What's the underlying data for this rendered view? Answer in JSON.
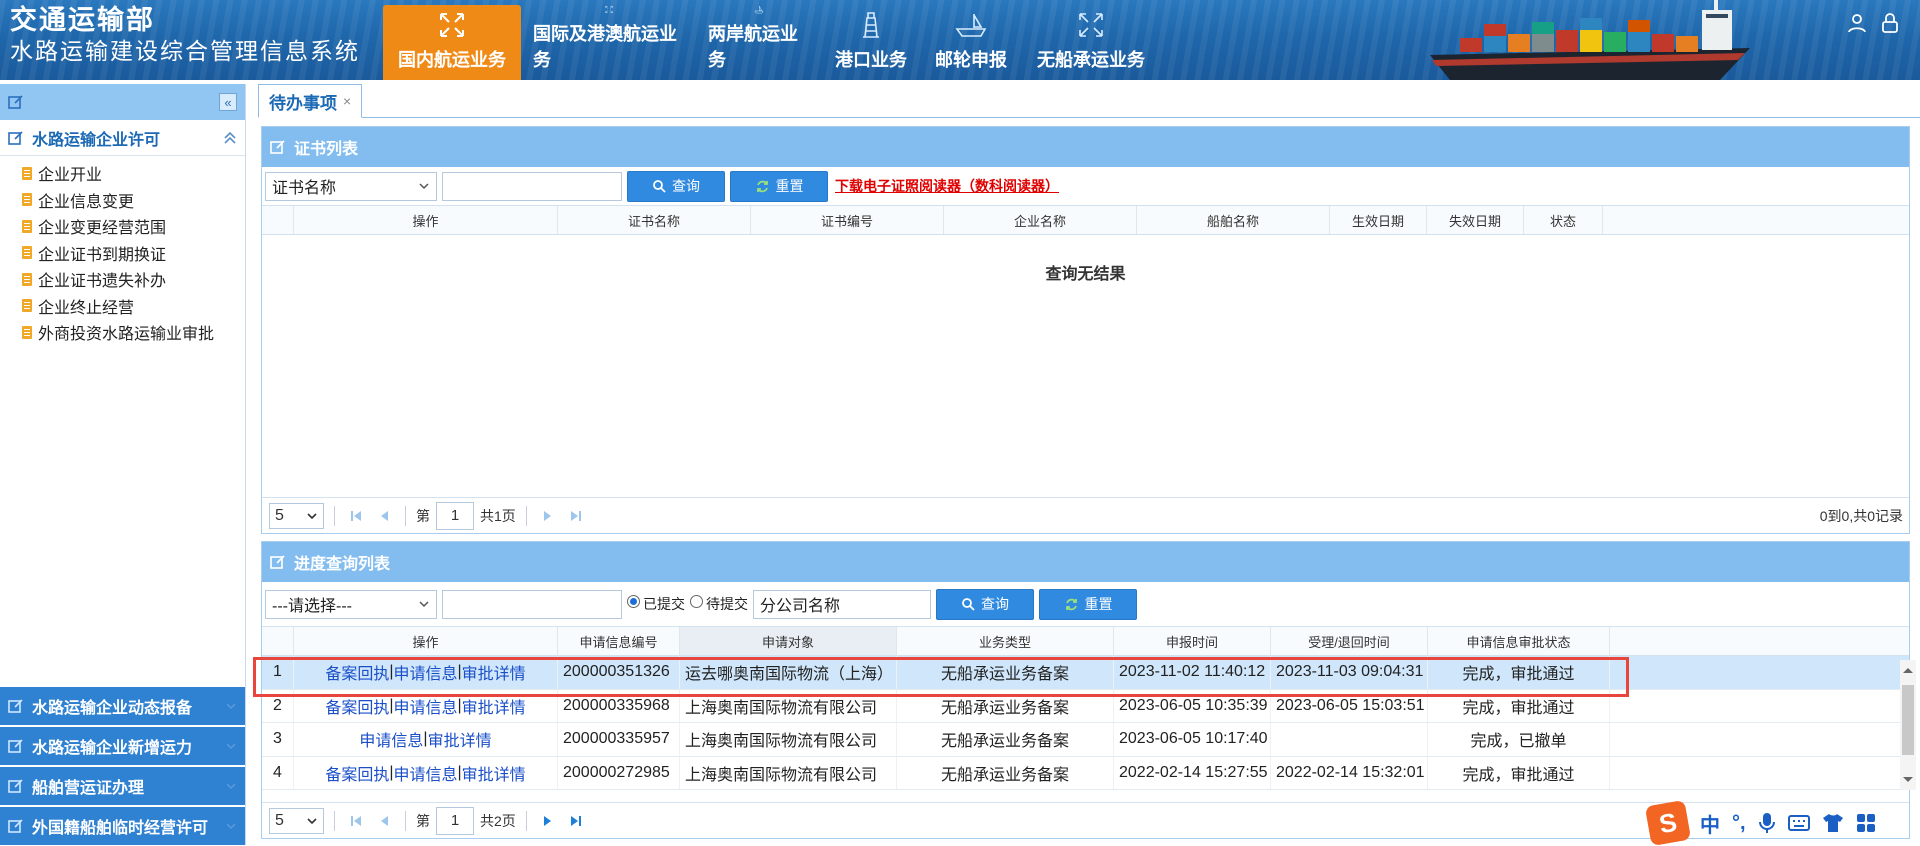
{
  "header": {
    "org": "交通运输部",
    "system": "水路运输建设综合管理信息系统",
    "nav": [
      "国内航运业务",
      "国际及港澳航运业务",
      "两岸航运业务",
      "港口业务",
      "邮轮申报",
      "无船承运业务"
    ],
    "active_nav": "国内航运业务",
    "accent": "#f08a17"
  },
  "sidebar": {
    "section_open": "水路运输企业许可",
    "items": [
      "企业开业",
      "企业信息变更",
      "企业变更经营范围",
      "企业证书到期换证",
      "企业证书遗失补办",
      "企业终止经营",
      "外商投资水路运输业审批"
    ],
    "sections_collapsed": [
      "水路运输企业动态报备",
      "水路运输企业新增运力",
      "船舶营运证办理",
      "外国籍船舶临时经营许可"
    ]
  },
  "tabs": [
    {
      "label": "待办事项",
      "close": "×"
    }
  ],
  "cert_panel": {
    "title": "证书列表",
    "select_value": "证书名称",
    "input_value": "",
    "query_label": "查询",
    "reset_label": "重置",
    "download_link": "下载电子证照阅读器（数科阅读器）",
    "columns": [
      "操作",
      "证书名称",
      "证书编号",
      "企业名称",
      "船舶名称",
      "生效日期",
      "失效日期",
      "状态"
    ],
    "empty_message": "查询无结果",
    "pager": {
      "page_size": "5",
      "page_prefix": "第",
      "page": "1",
      "total_pages": "共1页",
      "summary": "0到0,共0记录"
    }
  },
  "progress_panel": {
    "title": "进度查询列表",
    "select_value": "---请选择---",
    "input_value": "",
    "radio_submitted": "已提交",
    "radio_pending": "待提交",
    "branch_input": "分公司名称",
    "query_label": "查询",
    "reset_label": "重置",
    "columns": [
      "操作",
      "申请信息编号",
      "申请对象",
      "业务类型",
      "申报时间",
      "受理/退回时间",
      "申请信息审批状态"
    ],
    "rows": [
      {
        "no": "1",
        "ops": [
          "备案回执",
          "申请信息",
          "审批详情"
        ],
        "id": "200000351326",
        "target": "运去哪奥南国际物流（上海）",
        "type": "无船承运业务备案",
        "submit": "2023-11-02 11:40:12",
        "accept": "2023-11-03 09:04:31",
        "status": "完成，审批通过"
      },
      {
        "no": "2",
        "ops": [
          "备案回执",
          "申请信息",
          "审批详情"
        ],
        "id": "200000335968",
        "target": "上海奥南国际物流有限公司",
        "type": "无船承运业务备案",
        "submit": "2023-06-05 10:35:39",
        "accept": "2023-06-05 15:03:51",
        "status": "完成，审批通过"
      },
      {
        "no": "3",
        "ops": [
          "申请信息",
          "审批详情"
        ],
        "id": "200000335957",
        "target": "上海奥南国际物流有限公司",
        "type": "无船承运业务备案",
        "submit": "2023-06-05 10:17:40",
        "accept": "",
        "status": "完成，已撤单"
      },
      {
        "no": "4",
        "ops": [
          "备案回执",
          "申请信息",
          "审批详情"
        ],
        "id": "200000272985",
        "target": "上海奥南国际物流有限公司",
        "type": "无船承运业务备案",
        "submit": "2022-02-14 15:27:55",
        "accept": "2022-02-14 15:32:01",
        "status": "完成，审批通过"
      }
    ],
    "pager": {
      "page_size": "5",
      "page_prefix": "第",
      "page": "1",
      "total_pages": "共2页"
    }
  },
  "ime": {
    "mode": "中"
  }
}
